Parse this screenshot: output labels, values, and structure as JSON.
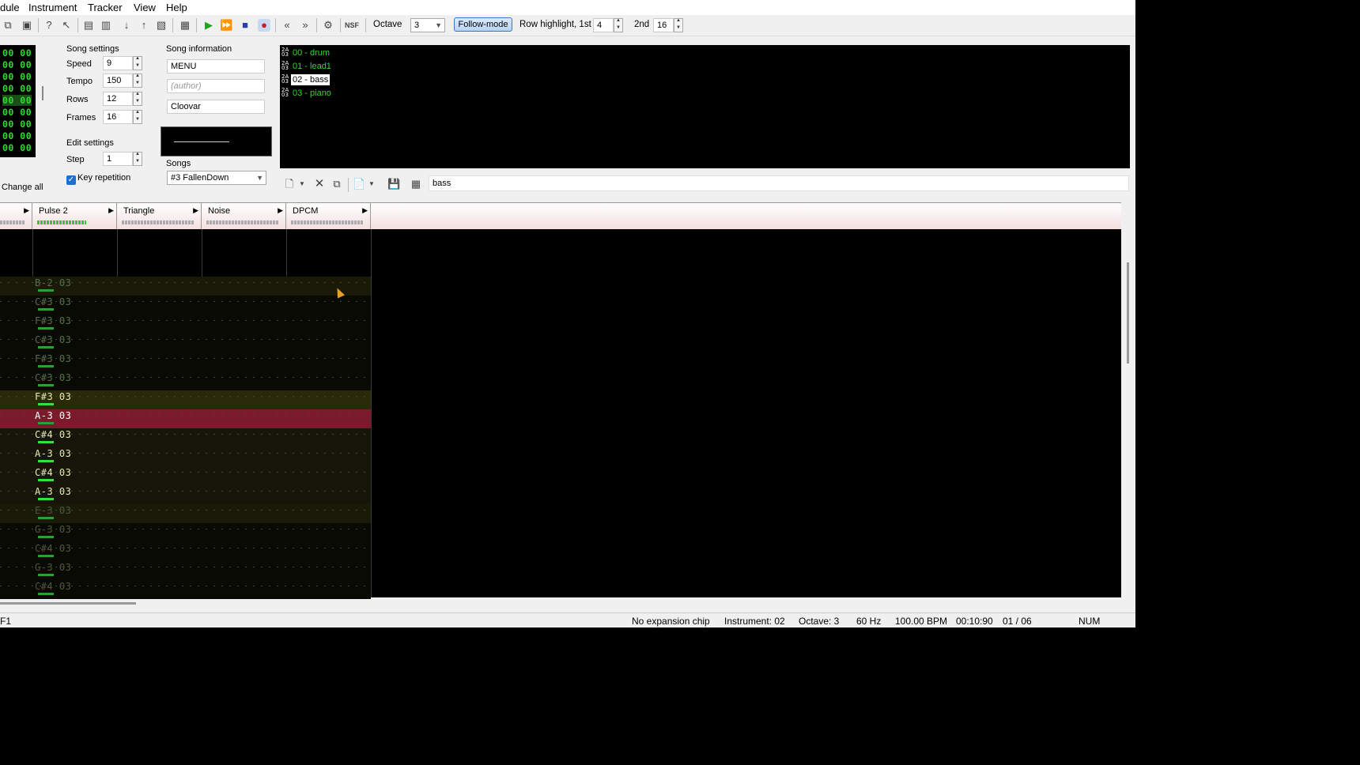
{
  "menu": [
    "dule",
    "Instrument",
    "Tracker",
    "View",
    "Help"
  ],
  "toolbar": {
    "octave_label": "Octave",
    "octave_value": "3",
    "follow_mode": "Follow-mode",
    "row_highlight_label": "Row highlight, 1st",
    "row_highlight_1st": "4",
    "second_label": "2nd",
    "row_highlight_2nd": "16"
  },
  "frames": [
    "00 00",
    "00 00",
    "00 00",
    "00 00",
    "00 00",
    "00 00",
    "00 00",
    "00 00",
    "00 00"
  ],
  "song_settings": {
    "title": "Song settings",
    "speed_label": "Speed",
    "speed": "9",
    "tempo_label": "Tempo",
    "tempo": "150",
    "rows_label": "Rows",
    "rows": "12",
    "frames_label": "Frames",
    "frames": "16"
  },
  "edit_settings": {
    "title": "Edit settings",
    "step_label": "Step",
    "step": "1",
    "key_repetition": "Key repetition",
    "change_all": "Change all"
  },
  "song_info": {
    "title": "Song information",
    "name": "MENU",
    "author_placeholder": "(author)",
    "copyright": "Cloovar"
  },
  "songs": {
    "title": "Songs",
    "selected": "#3 FallenDown"
  },
  "instruments": [
    "00 - drum",
    "01 - lead1",
    "02 - bass",
    "03 - piano"
  ],
  "instrument_icon": "2A 03",
  "instrument_name": "bass",
  "channels": [
    "Pulse 2",
    "Triangle",
    "Noise",
    "DPCM"
  ],
  "pattern_rows": [
    {
      "note": "B-2 03",
      "y": 0
    },
    {
      "note": "C#3 03"
    },
    {
      "note": "F#3 03"
    },
    {
      "note": "C#3 03"
    },
    {
      "note": "F#3 03"
    },
    {
      "note": "C#3 03"
    },
    {
      "note": "F#3 03"
    },
    {
      "note": "A-3 03"
    },
    {
      "note": "C#4 03"
    },
    {
      "note": "A-3 03"
    },
    {
      "note": "C#4 03"
    },
    {
      "note": "A-3 03"
    },
    {
      "note": "E-3 03"
    },
    {
      "note": "G-3 03"
    },
    {
      "note": "C#4 03"
    },
    {
      "note": "G-3 03"
    },
    {
      "note": "C#4 03"
    }
  ],
  "status": {
    "left": "F1",
    "chip": "No expansion chip",
    "instrument": "Instrument: 02",
    "octave": "Octave: 3",
    "rate": "60 Hz",
    "bpm": "100.00 BPM",
    "time": "00:10:90",
    "position": "01 / 06",
    "num": "NUM"
  }
}
